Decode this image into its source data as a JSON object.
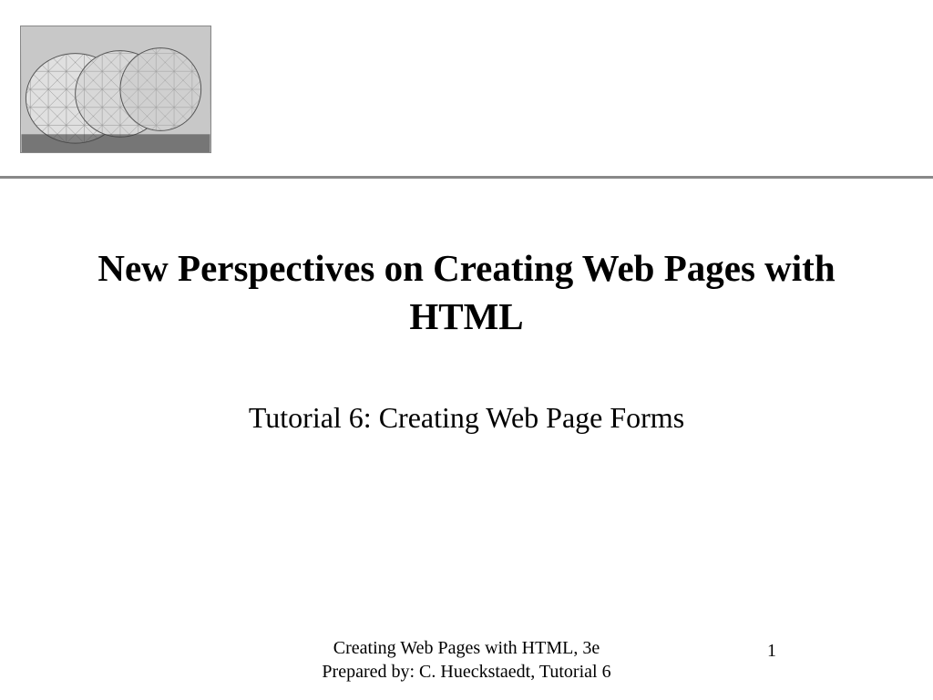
{
  "slide": {
    "title": "New Perspectives on Creating Web Pages with HTML",
    "subtitle": "Tutorial 6: Creating Web Page Forms",
    "footer_line1": "Creating Web Pages with HTML, 3e",
    "footer_line2": "Prepared by: C. Hueckstaedt, Tutorial 6",
    "page_number": "1"
  }
}
